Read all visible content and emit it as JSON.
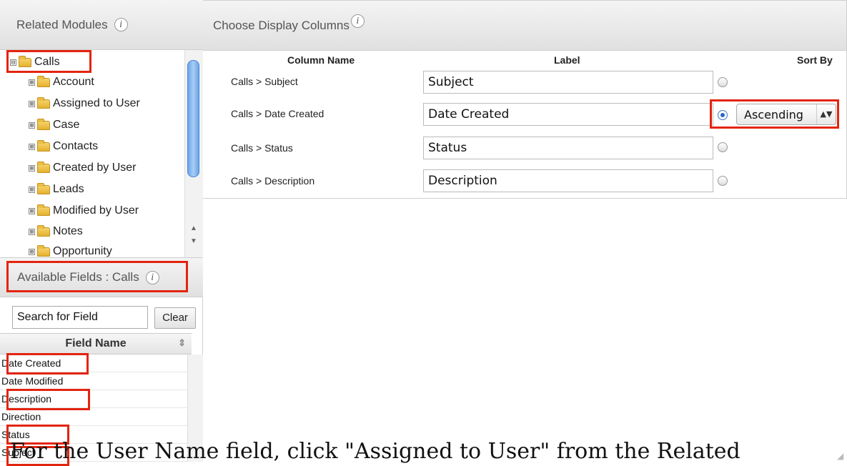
{
  "related_modules": {
    "title": "Related Modules",
    "info": "i",
    "tree": [
      {
        "label": "Calls",
        "toggle": "⊟",
        "level": 0
      },
      {
        "label": "Account",
        "toggle": "⊞",
        "level": 1
      },
      {
        "label": "Assigned to User",
        "toggle": "⊞",
        "level": 1
      },
      {
        "label": "Case",
        "toggle": "⊞",
        "level": 1
      },
      {
        "label": "Contacts",
        "toggle": "⊞",
        "level": 1
      },
      {
        "label": "Created by User",
        "toggle": "⊞",
        "level": 1
      },
      {
        "label": "Leads",
        "toggle": "⊞",
        "level": 1
      },
      {
        "label": "Modified by User",
        "toggle": "⊞",
        "level": 1
      },
      {
        "label": "Notes",
        "toggle": "⊞",
        "level": 1
      },
      {
        "label": "Opportunity",
        "toggle": "⊞",
        "level": 1
      }
    ],
    "scroll_up": "▲",
    "scroll_down": "▼"
  },
  "available_fields": {
    "title": "Available Fields : Calls",
    "info": "i",
    "search_placeholder": "Search for Field",
    "search_value": "Search for Field",
    "clear_label": "Clear",
    "column_header": "Field Name",
    "sort_icon": "⇕",
    "fields": [
      "Date Created",
      "Date Modified",
      "Description",
      "Direction",
      "Status",
      "Subject"
    ]
  },
  "display_columns": {
    "title": "Choose Display Columns",
    "info": "i",
    "headers": {
      "column_name": "Column Name",
      "label": "Label",
      "sort_by": "Sort By"
    },
    "rows": [
      {
        "column": "Calls > Subject",
        "label": "Subject",
        "sort_selected": false
      },
      {
        "column": "Calls > Date Created",
        "label": "Date Created",
        "sort_selected": true
      },
      {
        "column": "Calls > Status",
        "label": "Status",
        "sort_selected": false
      },
      {
        "column": "Calls > Description",
        "label": "Description",
        "sort_selected": false
      }
    ],
    "sort_order": {
      "value": "Ascending",
      "arrow": "▲▼"
    }
  },
  "caption": "For the User Name field, click \"Assigned to User\" from the Related",
  "highlight_color": "#e3240f"
}
